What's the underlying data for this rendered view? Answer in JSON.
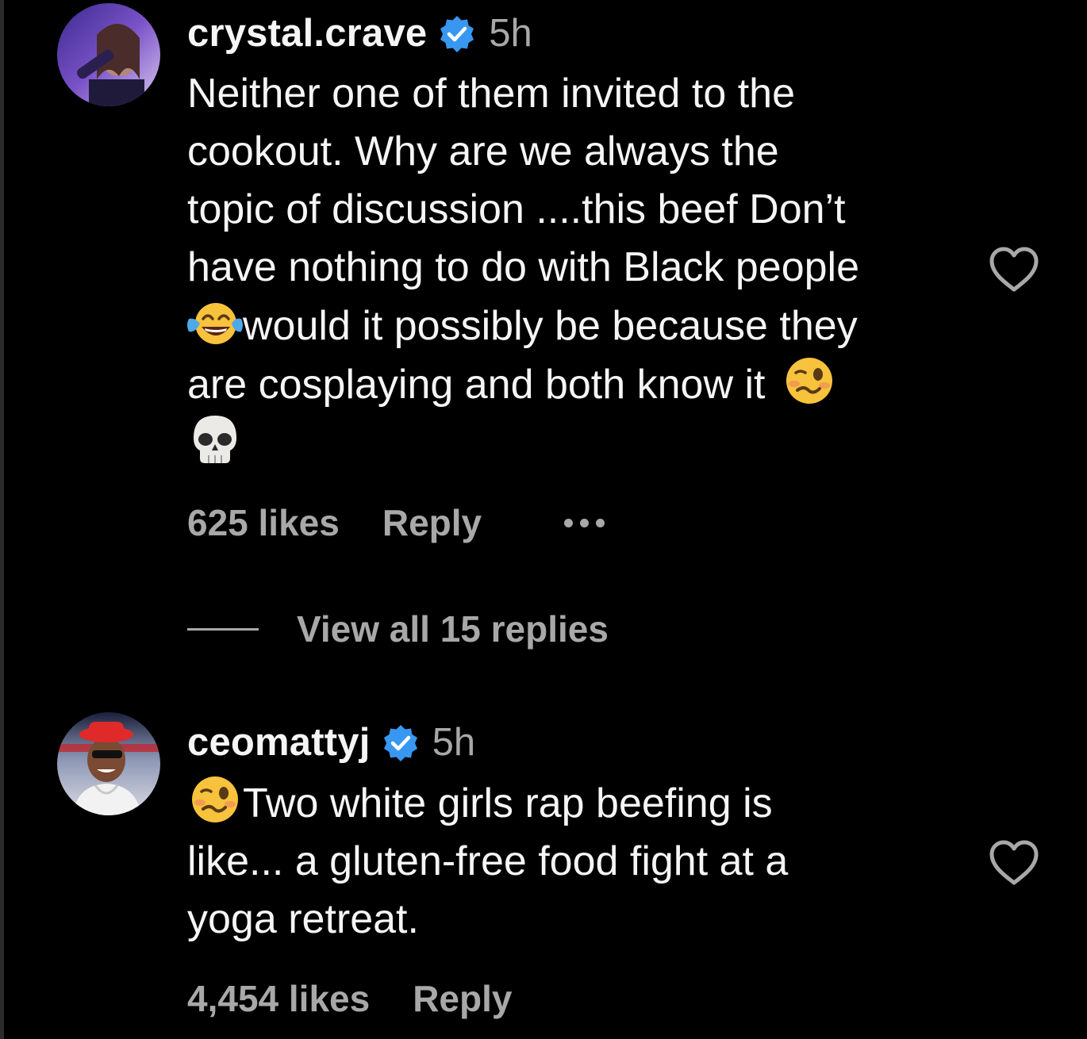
{
  "comments": [
    {
      "username": "crystal.crave",
      "verified": true,
      "time": "5h",
      "text_lines": [
        "Neither one of them invited to the",
        "cookout. Why are we always the",
        "topic of discussion ....this beef Don’t",
        "have nothing to do with Black people",
        "would it possibly be because they",
        "are cosplaying and both know it"
      ],
      "emojis": [
        "face-with-tears-of-joy",
        "woozy-face",
        "skull"
      ],
      "likes": "625 likes",
      "reply_label": "Reply",
      "view_replies_label": "View all 15 replies"
    },
    {
      "username": "ceomattyj",
      "verified": true,
      "time": "5h",
      "text_lines": [
        "Two white girls rap beefing is",
        "like... a gluten-free food fight at a",
        "yoga retreat."
      ],
      "emojis": [
        "woozy-face"
      ],
      "likes": "4,454 likes",
      "reply_label": "Reply"
    }
  ],
  "icons": {
    "verified": "verified-badge-icon",
    "like": "heart-outline-icon",
    "more": "more-options-icon"
  },
  "colors": {
    "background": "#000000",
    "primary_text": "#f5f5f5",
    "secondary_text": "#a8a8a8",
    "verified_blue": "#3897f0"
  }
}
